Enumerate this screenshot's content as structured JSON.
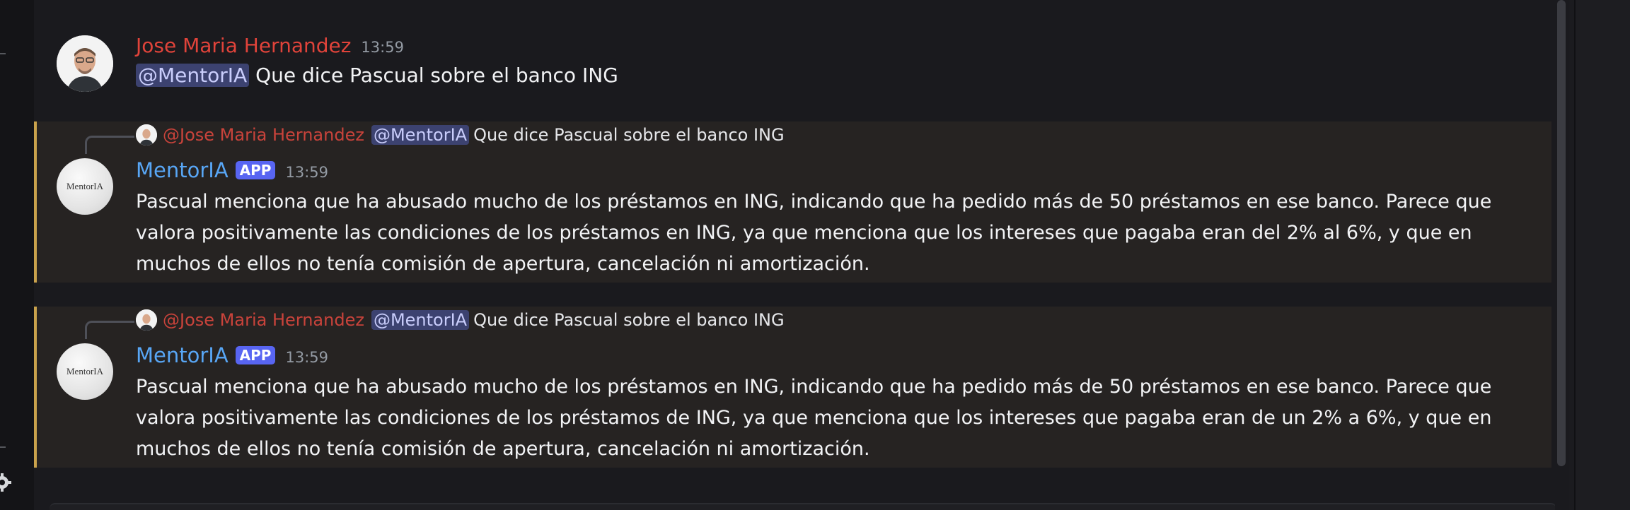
{
  "messages": [
    {
      "author": "Jose Maria Hernandez",
      "time": "13:59",
      "mention": "@MentorIA",
      "text": "Que dice Pascual sobre el banco ING"
    },
    {
      "reply": {
        "author": "@Jose Maria Hernandez",
        "mention": "@MentorIA",
        "text": "Que dice Pascual sobre el banco ING"
      },
      "author": "MentorIA",
      "badge": "APP",
      "time": "13:59",
      "avatar_text": "MentorIA",
      "lines": [
        "Pascual menciona que ha abusado mucho de los préstamos en ING, indicando que ha pedido más de 50 préstamos en ese banco. Parece que",
        "valora positivamente las condiciones de los préstamos en ING, ya que menciona que los intereses que pagaba eran del 2% al 6%, y que en",
        "muchos de ellos no tenía comisión de apertura, cancelación ni amortización."
      ]
    },
    {
      "reply": {
        "author": "@Jose Maria Hernandez",
        "mention": "@MentorIA",
        "text": "Que dice Pascual sobre el banco ING"
      },
      "author": "MentorIA",
      "badge": "APP",
      "time": "13:59",
      "avatar_text": "MentorIA",
      "lines": [
        "Pascual menciona que ha abusado mucho de los préstamos en ING, indicando que ha pedido más de 50 préstamos en ese banco. Parece que",
        "valora positivamente las condiciones de los préstamos de ING, ya que menciona que los intereses que pagaba eran de un 2% a 6%, y que en",
        "muchos de ellos no tenía comisión de apertura, cancelación ni amortización."
      ]
    }
  ],
  "colors": {
    "background": "#1a1a1e",
    "highlight_bg": "#262322",
    "highlight_bar": "#c9a24c",
    "user_name": "#e0433a",
    "bot_name": "#58a6f5",
    "mention_bg": "#3c4270",
    "badge_bg": "#5865f2"
  }
}
